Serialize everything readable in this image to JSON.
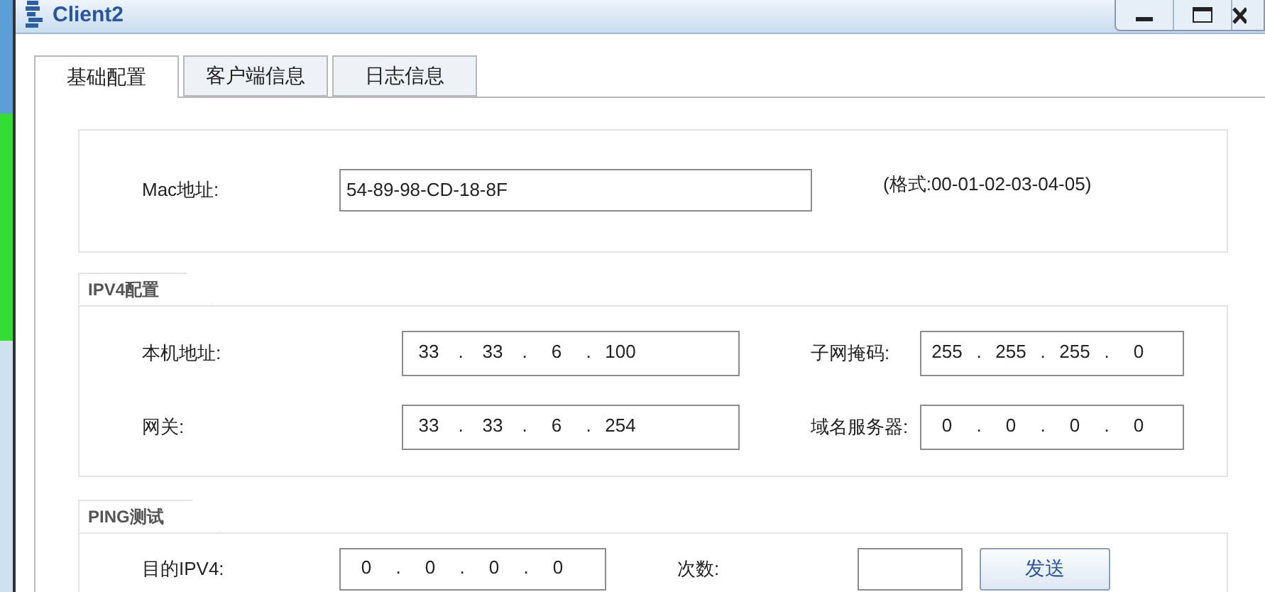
{
  "window": {
    "title": "Client2"
  },
  "tabs": [
    {
      "label": "基础配置",
      "selected": true
    },
    {
      "label": "客户端信息",
      "selected": false
    },
    {
      "label": "日志信息",
      "selected": false
    }
  ],
  "mac": {
    "label": "Mac地址:",
    "value": "54-89-98-CD-18-8F",
    "hint": "(格式:00-01-02-03-04-05)"
  },
  "ipv4": {
    "title": "IPV4配置",
    "fields": [
      {
        "label": "本机地址:",
        "parts": [
          "33",
          ".",
          "33",
          ".",
          "6",
          ".",
          "100"
        ]
      },
      {
        "label": "子网掩码:",
        "parts": [
          "255",
          ".",
          "255",
          ".",
          "255",
          ".",
          "0"
        ]
      },
      {
        "label": "网关:",
        "parts": [
          "33",
          ".",
          "33",
          ".",
          "6",
          ".",
          "254"
        ]
      },
      {
        "label": "域名服务器:",
        "parts": [
          "0",
          ".",
          "0",
          ".",
          "0",
          ".",
          "0"
        ]
      }
    ]
  },
  "ping": {
    "title": "PING测试",
    "target": {
      "label": "目的IPV4:",
      "parts": [
        "0",
        ".",
        "0",
        ".",
        "0",
        ".",
        "0"
      ]
    },
    "count": {
      "label": "次数:"
    },
    "send_button": "发送"
  }
}
